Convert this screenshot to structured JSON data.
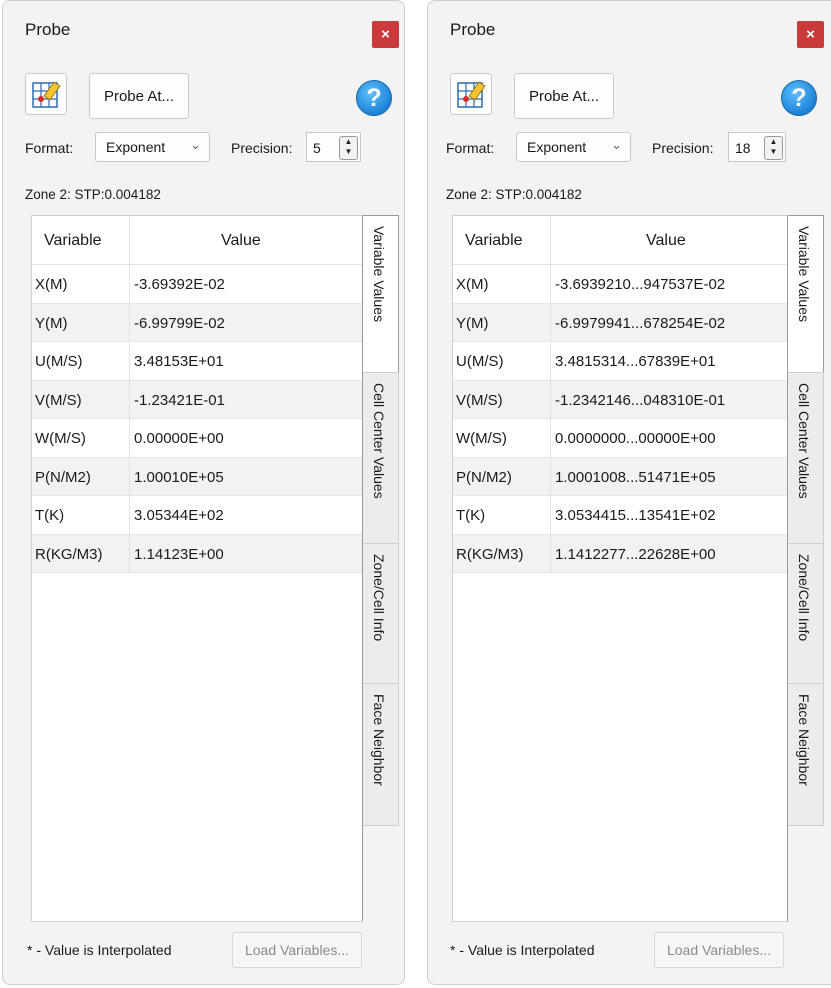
{
  "panels": [
    {
      "title": "Probe",
      "close_label": "×",
      "probe_at_label": "Probe At...",
      "help_label": "?",
      "format_label": "Format:",
      "format_value": "Exponent",
      "precision_label": "Precision:",
      "precision_value": "5",
      "zone_text": "Zone 2: STP:0.004182",
      "col_variable": "Variable",
      "col_value": "Value",
      "rows": [
        {
          "variable": "X(M)",
          "value": "-3.69392E-02"
        },
        {
          "variable": "Y(M)",
          "value": "-6.99799E-02"
        },
        {
          "variable": "U(M/S)",
          "value": "3.48153E+01"
        },
        {
          "variable": "V(M/S)",
          "value": "-1.23421E-01"
        },
        {
          "variable": "W(M/S)",
          "value": "0.00000E+00"
        },
        {
          "variable": "P(N/M2)",
          "value": "1.00010E+05"
        },
        {
          "variable": "T(K)",
          "value": "3.05344E+02"
        },
        {
          "variable": "R(KG/M3)",
          "value": "1.14123E+00"
        }
      ],
      "tabs": [
        "Variable Values",
        "Cell Center Values",
        "Zone/Cell Info",
        "Face Neighbor"
      ],
      "footer_note": "* - Value is Interpolated",
      "load_variables_label": "Load Variables..."
    },
    {
      "title": "Probe",
      "close_label": "×",
      "probe_at_label": "Probe At...",
      "help_label": "?",
      "format_label": "Format:",
      "format_value": "Exponent",
      "precision_label": "Precision:",
      "precision_value": "18",
      "zone_text": "Zone 2: STP:0.004182",
      "col_variable": "Variable",
      "col_value": "Value",
      "rows": [
        {
          "variable": "X(M)",
          "value": "-3.6939210...947537E-02"
        },
        {
          "variable": "Y(M)",
          "value": "-6.9979941...678254E-02"
        },
        {
          "variable": "U(M/S)",
          "value": "3.4815314...67839E+01"
        },
        {
          "variable": "V(M/S)",
          "value": "-1.2342146...048310E-01"
        },
        {
          "variable": "W(M/S)",
          "value": "0.0000000...00000E+00"
        },
        {
          "variable": "P(N/M2)",
          "value": "1.0001008...51471E+05"
        },
        {
          "variable": "T(K)",
          "value": "3.0534415...13541E+02"
        },
        {
          "variable": "R(KG/M3)",
          "value": "1.1412277...22628E+00"
        }
      ],
      "tabs": [
        "Variable Values",
        "Cell Center Values",
        "Zone/Cell Info",
        "Face Neighbor"
      ],
      "footer_note": "* - Value is Interpolated",
      "load_variables_label": "Load Variables..."
    }
  ],
  "colors": {
    "close_button": "#cb3a3a",
    "help_icon": "#1c82d6",
    "alt_row": "#f2f2f2"
  },
  "icons": {
    "probe_tool": "probe-grid-icon",
    "help": "help-icon",
    "close": "close-icon",
    "dropdown": "chevron-down-icon",
    "spinner": "spinner-arrows-icon"
  }
}
